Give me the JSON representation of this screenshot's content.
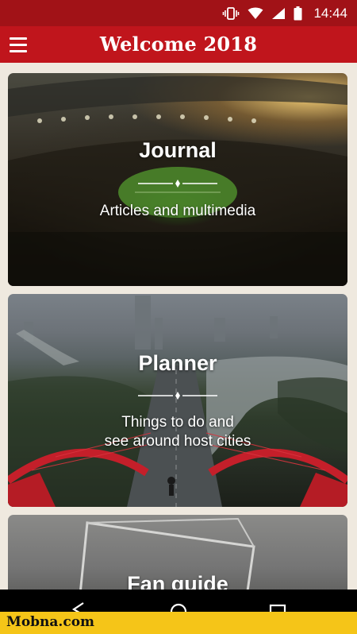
{
  "status_bar": {
    "time": "14:44",
    "icons": [
      "vibrate-icon",
      "wifi-icon",
      "signal-icon",
      "battery-icon"
    ]
  },
  "app_bar": {
    "title": "Welcome 2018",
    "menu_icon": "hamburger-menu-icon",
    "background_color": "#c0151c"
  },
  "cards": [
    {
      "title": "Journal",
      "subtitle": "Articles and multimedia"
    },
    {
      "title": "Planner",
      "subtitle": "Things to do and\nsee around host cities"
    },
    {
      "title": "Fan guide",
      "subtitle": ""
    }
  ],
  "nav_bar": {
    "buttons": [
      "back-icon",
      "home-icon",
      "recents-icon"
    ]
  },
  "watermark": {
    "text": "Mobna.com"
  }
}
